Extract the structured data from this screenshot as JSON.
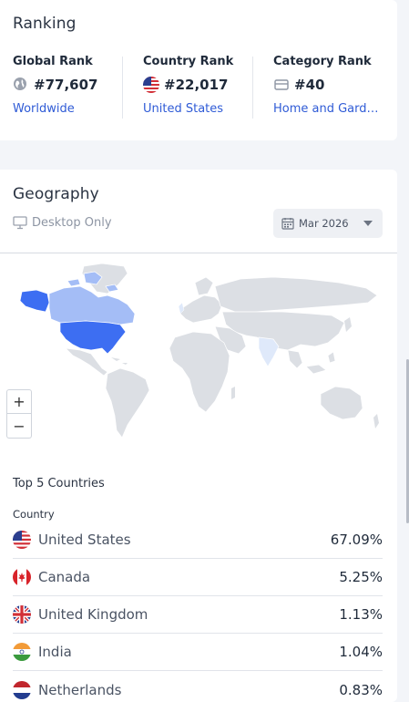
{
  "ranking": {
    "title": "Ranking",
    "global": {
      "label": "Global Rank",
      "value": "#77,607",
      "link": "Worldwide",
      "icon": "globe-icon"
    },
    "country": {
      "label": "Country Rank",
      "value": "#22,017",
      "link": "United States",
      "icon": "us-flag-icon"
    },
    "category": {
      "label": "Category Rank",
      "value": "#40",
      "link": "Home and Garde…",
      "icon": "category-icon"
    }
  },
  "geography": {
    "title": "Geography",
    "device": "Desktop Only",
    "date": "Mar 2026",
    "zoom_in": "+",
    "zoom_out": "−",
    "top_title": "Top 5 Countries",
    "column_header": "Country",
    "countries": [
      {
        "name": "United States",
        "share": "67.09%",
        "flag": "us-flag-icon"
      },
      {
        "name": "Canada",
        "share": "5.25%",
        "flag": "canada-flag-icon"
      },
      {
        "name": "United Kingdom",
        "share": "1.13%",
        "flag": "uk-flag-icon"
      },
      {
        "name": "India",
        "share": "1.04%",
        "flag": "india-flag-icon"
      },
      {
        "name": "Netherlands",
        "share": "0.83%",
        "flag": "netherlands-flag-icon"
      }
    ]
  },
  "colors": {
    "accent": "#2f5bd6",
    "map_land": "#dcdfe4",
    "map_high": "#3d6ef2",
    "map_mid": "#a4bdf6",
    "map_low": "#dfe9fa"
  }
}
